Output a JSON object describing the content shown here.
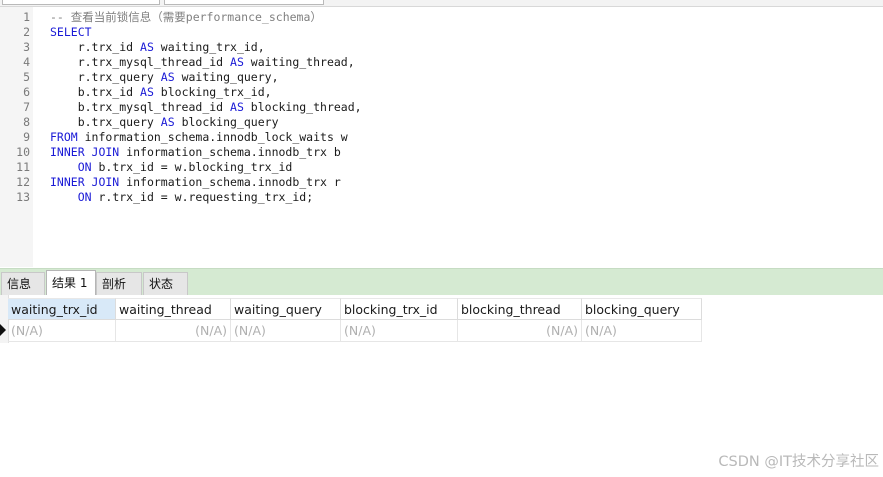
{
  "editor": {
    "lines": [
      {
        "num": "1",
        "segments": [
          {
            "t": "-- 查看当前锁信息（需要performance_schema）",
            "c": "cm"
          }
        ]
      },
      {
        "num": "2",
        "segments": [
          {
            "t": "SELECT",
            "c": "kw"
          }
        ]
      },
      {
        "num": "3",
        "segments": [
          {
            "t": "    r.trx_id ",
            "c": ""
          },
          {
            "t": "AS",
            "c": "kw"
          },
          {
            "t": " waiting_trx_id,",
            "c": ""
          }
        ]
      },
      {
        "num": "4",
        "segments": [
          {
            "t": "    r.trx_mysql_thread_id ",
            "c": ""
          },
          {
            "t": "AS",
            "c": "kw"
          },
          {
            "t": " waiting_thread,",
            "c": ""
          }
        ]
      },
      {
        "num": "5",
        "segments": [
          {
            "t": "    r.trx_query ",
            "c": ""
          },
          {
            "t": "AS",
            "c": "kw"
          },
          {
            "t": " waiting_query,",
            "c": ""
          }
        ]
      },
      {
        "num": "6",
        "segments": [
          {
            "t": "    b.trx_id ",
            "c": ""
          },
          {
            "t": "AS",
            "c": "kw"
          },
          {
            "t": " blocking_trx_id,",
            "c": ""
          }
        ]
      },
      {
        "num": "7",
        "segments": [
          {
            "t": "    b.trx_mysql_thread_id ",
            "c": ""
          },
          {
            "t": "AS",
            "c": "kw"
          },
          {
            "t": " blocking_thread,",
            "c": ""
          }
        ]
      },
      {
        "num": "8",
        "segments": [
          {
            "t": "    b.trx_query ",
            "c": ""
          },
          {
            "t": "AS",
            "c": "kw"
          },
          {
            "t": " blocking_query",
            "c": ""
          }
        ]
      },
      {
        "num": "9",
        "segments": [
          {
            "t": "FROM",
            "c": "kw"
          },
          {
            "t": " information_schema.innodb_lock_waits w",
            "c": ""
          }
        ]
      },
      {
        "num": "10",
        "segments": [
          {
            "t": "INNER JOIN",
            "c": "kw"
          },
          {
            "t": " information_schema.innodb_trx b",
            "c": ""
          }
        ]
      },
      {
        "num": "11",
        "segments": [
          {
            "t": "    ",
            "c": ""
          },
          {
            "t": "ON",
            "c": "kw"
          },
          {
            "t": " b.trx_id = w.blocking_trx_id",
            "c": ""
          }
        ]
      },
      {
        "num": "12",
        "segments": [
          {
            "t": "INNER JOIN",
            "c": "kw"
          },
          {
            "t": " information_schema.innodb_trx r",
            "c": ""
          }
        ]
      },
      {
        "num": "13",
        "segments": [
          {
            "t": "    ",
            "c": ""
          },
          {
            "t": "ON",
            "c": "kw"
          },
          {
            "t": " r.trx_id = w.requesting_trx_id;",
            "c": ""
          }
        ]
      }
    ]
  },
  "results": {
    "tabs": [
      {
        "label": "信息",
        "name": "tab-info",
        "active": false
      },
      {
        "label": "结果 1",
        "name": "tab-result-1",
        "active": true
      },
      {
        "label": "剖析",
        "name": "tab-profile",
        "active": false
      },
      {
        "label": "状态",
        "name": "tab-status",
        "active": false
      }
    ],
    "columns": [
      "waiting_trx_id",
      "waiting_thread",
      "waiting_query",
      "blocking_trx_id",
      "blocking_thread",
      "blocking_query"
    ],
    "rows": [
      [
        "(N/A)",
        "(N/A)",
        "(N/A)",
        "(N/A)",
        "(N/A)",
        "(N/A)"
      ]
    ]
  },
  "watermark": "CSDN @IT技术分享社区"
}
